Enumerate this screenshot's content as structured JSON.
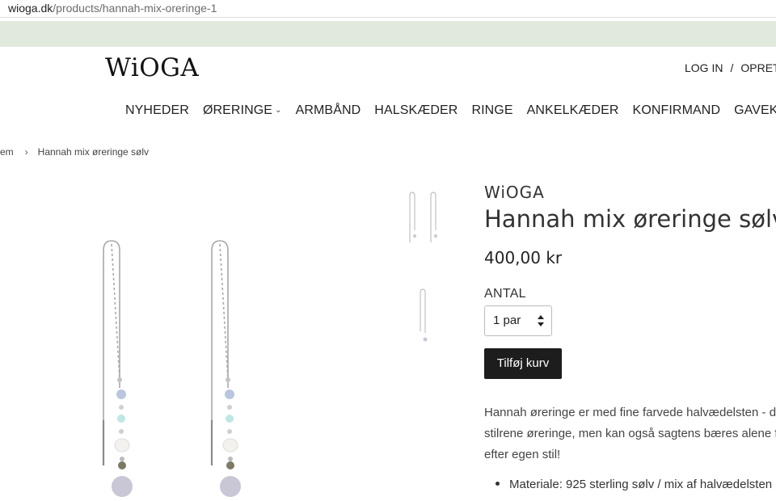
{
  "browser": {
    "url_domain": "wioga.dk",
    "url_path": "/products/hannah-mix-oreringe-1"
  },
  "header": {
    "logo_text": "WiOGA",
    "login_label": "LOG IN",
    "separator": "/",
    "create_label": "OPRET"
  },
  "nav": {
    "items": [
      "NYHEDER",
      "ØRERINGE",
      "ARMBÅND",
      "HALSKÆDER",
      "RINGE",
      "ANKELKÆDER",
      "KONFIRMAND",
      "GAVEKORT"
    ]
  },
  "breadcrumb": {
    "home": "em",
    "arrow": "›",
    "current": "Hannah mix øreringe sølv"
  },
  "product": {
    "vendor": "WiOGA",
    "title": "Hannah mix øreringe sølv",
    "price": "400,00 kr",
    "quantity_label": "ANTAL",
    "quantity_value": "1 par",
    "add_to_cart_label": "Tilføj kurv",
    "description_lines": [
      "Hannah øreringe er med fine farvede halvædelsten - de",
      "stilrene øreringe, men kan også sagtens bæres alene f",
      "efter egen stil!"
    ],
    "features": [
      "Materiale: 925 sterling sølv / mix af halvædelsten"
    ]
  },
  "colors": {
    "announcement_bar": "#e1e8de",
    "button_bg": "#1d1d1d",
    "accent_stone_blue": "#b9c6dd",
    "accent_stone_aqua": "#bfe6e6"
  },
  "icons": [
    "chevron-down-icon",
    "select-arrows-icon",
    "breadcrumb-arrow-icon"
  ]
}
